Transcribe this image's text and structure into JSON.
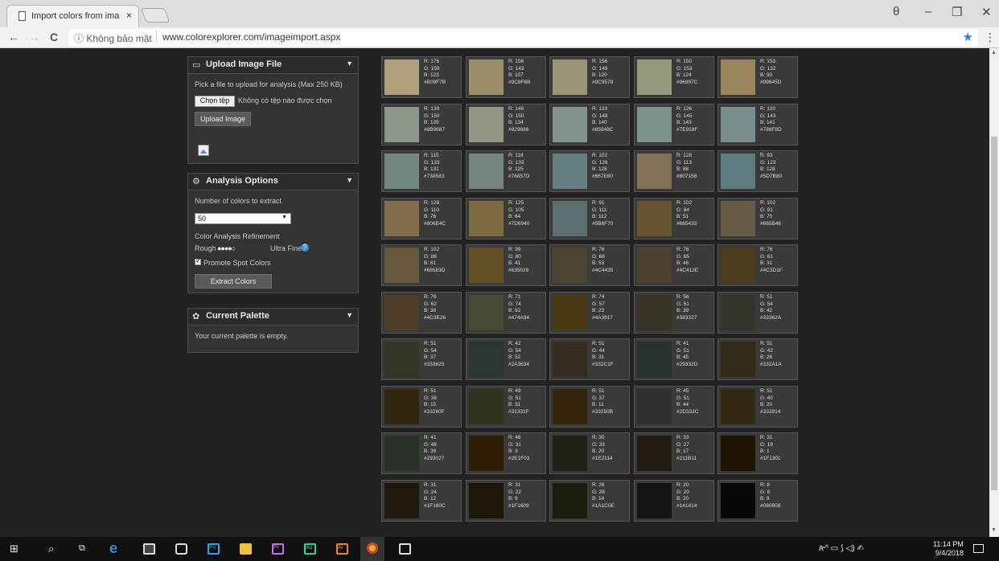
{
  "browser": {
    "tab_title": "Import colors from image",
    "tab_close": "×",
    "security_label": "ⓘ Không bảo mật",
    "url": "www.colorexplorer.com/imageimport.aspx",
    "back": "←",
    "forward": "→",
    "reload": "C",
    "star": "★",
    "menu": "⋮",
    "profile": "θ",
    "minimize": "–",
    "maximize": "❐",
    "close": "✕"
  },
  "upload_panel": {
    "title": "Upload Image File",
    "caret": "▼",
    "instructions": "Pick a file to upload for analysis (Max 250 KB)",
    "choose_file_label": "Chọn tệp",
    "no_file_label": "Không có tệp nào được chọn",
    "upload_button": "Upload Image"
  },
  "analysis_panel": {
    "title": "Analysis Options",
    "caret": "▼",
    "colors_label": "Number of colors to extract",
    "colors_value": "50",
    "refinement_label": "Color Analysis Refinement",
    "rough_label": "Rough",
    "refinement_level": 4,
    "refinement_levels": 5,
    "dots": "●●●●○",
    "ultra_fine_label": "Ultra Fine",
    "help": "?",
    "promote_label": "Promote Spot Colors",
    "promote_checked": true,
    "extract_button": "Extract Colors"
  },
  "palette_panel": {
    "title": "Current Palette",
    "caret": "▼",
    "empty_message": "Your current palette is empty."
  },
  "colors": [
    {
      "r": 176,
      "g": 159,
      "b": 123,
      "hex": "#B09F7B"
    },
    {
      "r": 156,
      "g": 143,
      "b": 107,
      "hex": "#9C8F6B"
    },
    {
      "r": 156,
      "g": 149,
      "b": 120,
      "hex": "#9C9578"
    },
    {
      "r": 150,
      "g": 153,
      "b": 124,
      "hex": "#96997C"
    },
    {
      "r": 153,
      "g": 132,
      "b": 93,
      "hex": "#99845D"
    },
    {
      "r": 139,
      "g": 150,
      "b": 135,
      "hex": "#8B9687"
    },
    {
      "r": 146,
      "g": 150,
      "b": 134,
      "hex": "#929686"
    },
    {
      "r": 133,
      "g": 148,
      "b": 140,
      "hex": "#85948C"
    },
    {
      "r": 126,
      "g": 145,
      "b": 143,
      "hex": "#7E918F"
    },
    {
      "r": 120,
      "g": 143,
      "b": 141,
      "hex": "#788F8D"
    },
    {
      "r": 115,
      "g": 133,
      "b": 131,
      "hex": "#738583"
    },
    {
      "r": 118,
      "g": 133,
      "b": 125,
      "hex": "#76857D"
    },
    {
      "r": 102,
      "g": 126,
      "b": 128,
      "hex": "#667E80"
    },
    {
      "r": 128,
      "g": 113,
      "b": 88,
      "hex": "#807158"
    },
    {
      "r": 93,
      "g": 123,
      "b": 128,
      "hex": "#5D7B80"
    },
    {
      "r": 128,
      "g": 110,
      "b": 76,
      "hex": "#806E4C"
    },
    {
      "r": 125,
      "g": 105,
      "b": 64,
      "hex": "#7D6940"
    },
    {
      "r": 91,
      "g": 111,
      "b": 112,
      "hex": "#5B6F70"
    },
    {
      "r": 102,
      "g": 84,
      "b": 51,
      "hex": "#665433"
    },
    {
      "r": 102,
      "g": 91,
      "b": 70,
      "hex": "#665B46"
    },
    {
      "r": 102,
      "g": 88,
      "b": 61,
      "hex": "#66583D"
    },
    {
      "r": 99,
      "g": 80,
      "b": 41,
      "hex": "#635029"
    },
    {
      "r": 76,
      "g": 68,
      "b": 53,
      "hex": "#4C4435"
    },
    {
      "r": 76,
      "g": 65,
      "b": 46,
      "hex": "#4C412E"
    },
    {
      "r": 76,
      "g": 61,
      "b": 31,
      "hex": "#4C3D1F"
    },
    {
      "r": 76,
      "g": 62,
      "b": 38,
      "hex": "#4C3E26"
    },
    {
      "r": 71,
      "g": 74,
      "b": 52,
      "hex": "#474A34"
    },
    {
      "r": 74,
      "g": 57,
      "b": 23,
      "hex": "#4A3917"
    },
    {
      "r": 56,
      "g": 51,
      "b": 39,
      "hex": "#383327"
    },
    {
      "r": 51,
      "g": 54,
      "b": 42,
      "hex": "#33362A"
    },
    {
      "r": 51,
      "g": 54,
      "b": 37,
      "hex": "#333625"
    },
    {
      "r": 42,
      "g": 54,
      "b": 52,
      "hex": "#2A3634"
    },
    {
      "r": 51,
      "g": 44,
      "b": 31,
      "hex": "#332C1F"
    },
    {
      "r": 41,
      "g": 51,
      "b": 45,
      "hex": "#29332D"
    },
    {
      "r": 51,
      "g": 42,
      "b": 26,
      "hex": "#332A1A"
    },
    {
      "r": 51,
      "g": 38,
      "b": 15,
      "hex": "#33260F"
    },
    {
      "r": 49,
      "g": 51,
      "b": 31,
      "hex": "#31331F"
    },
    {
      "r": 51,
      "g": 37,
      "b": 11,
      "hex": "#33250B"
    },
    {
      "r": 45,
      "g": 51,
      "b": 44,
      "hex": "#2D332C"
    },
    {
      "r": 51,
      "g": 40,
      "b": 20,
      "hex": "#332814"
    },
    {
      "r": 41,
      "g": 48,
      "b": 39,
      "hex": "#293027"
    },
    {
      "r": 46,
      "g": 31,
      "b": 3,
      "hex": "#2E1F03"
    },
    {
      "r": 30,
      "g": 33,
      "b": 20,
      "hex": "#1E2114"
    },
    {
      "r": 33,
      "g": 27,
      "b": 17,
      "hex": "#211B11"
    },
    {
      "r": 31,
      "g": 19,
      "b": 1,
      "hex": "#1F1301"
    },
    {
      "r": 31,
      "g": 24,
      "b": 12,
      "hex": "#1F180C"
    },
    {
      "r": 31,
      "g": 22,
      "b": 9,
      "hex": "#1F1609"
    },
    {
      "r": 26,
      "g": 28,
      "b": 14,
      "hex": "#1A1C0E"
    },
    {
      "r": 20,
      "g": 20,
      "b": 20,
      "hex": "#141414"
    },
    {
      "r": 8,
      "g": 8,
      "b": 8,
      "hex": "#080808"
    }
  ],
  "taskbar": {
    "ps_label": "Ps",
    "pr_label": "Pr",
    "au_label": "Au",
    "ai_label": "Ai",
    "tray_text": "ጵ^ ▭ ⟆ ◁) ✍",
    "time": "11:14 PM",
    "date": "9/4/2018"
  }
}
